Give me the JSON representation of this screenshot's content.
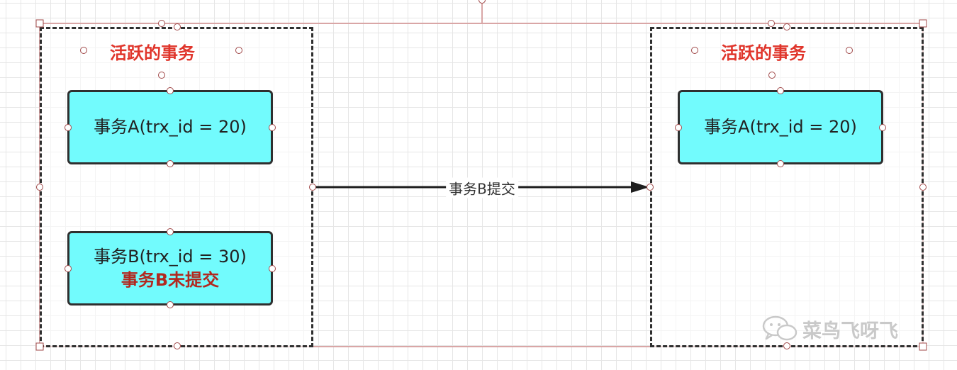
{
  "left_group": {
    "title": "活跃的事务",
    "tx_a": "事务A(trx_id = 20)",
    "tx_b": "事务B(trx_id = 30)",
    "tx_b_note": "事务B未提交"
  },
  "right_group": {
    "title": "活跃的事务",
    "tx_a": "事务A(trx_id = 20)"
  },
  "edge": {
    "label": "事务B提交"
  },
  "watermark": {
    "text": "菜鸟飞呀飞",
    "icon": "wechat-icon"
  },
  "colors": {
    "title_red": "#e0352b",
    "note_red": "#b2281f",
    "box_fill": "#72fbfd",
    "outline": "#2f2f2f"
  }
}
